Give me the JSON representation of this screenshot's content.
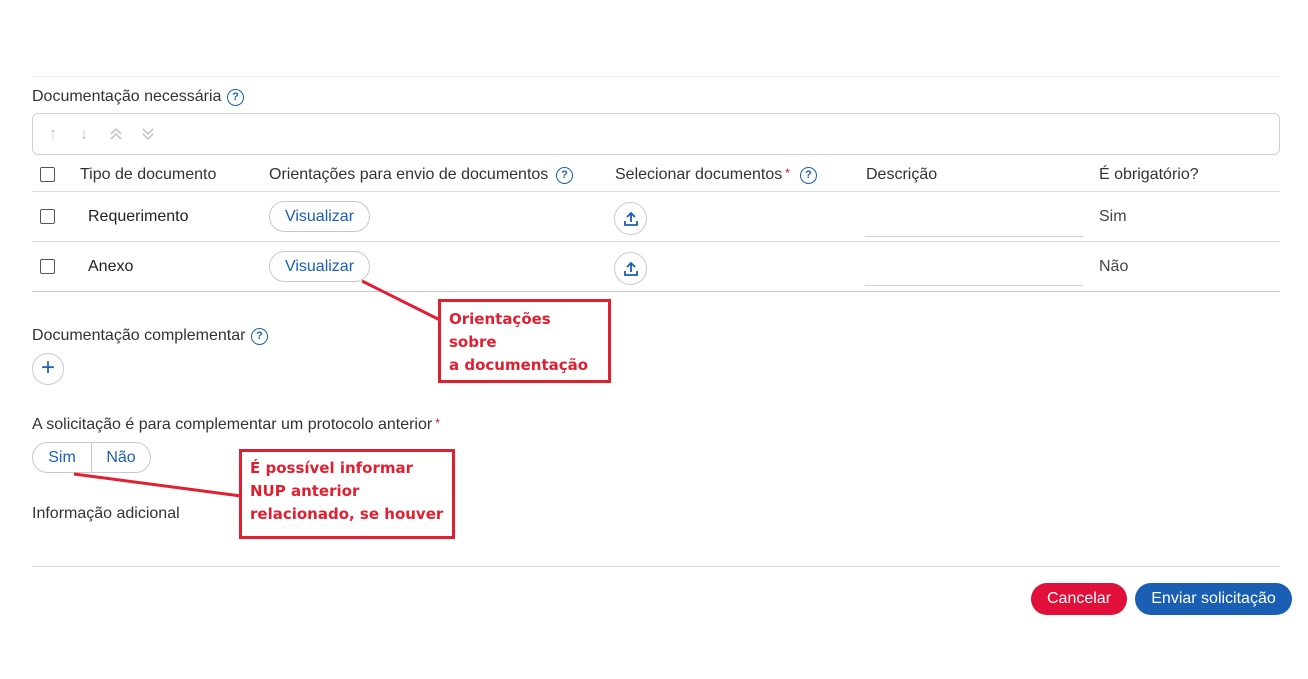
{
  "documentacao_necessaria": {
    "label": "Documentação necessária",
    "help_icon": "question-circle-icon",
    "toolbar": {
      "icons": [
        "arrow-up-icon",
        "arrow-down-icon",
        "double-arrow-up-icon",
        "double-arrow-down-icon"
      ]
    },
    "columns": {
      "tipo": "Tipo de documento",
      "orientacoes": "Orientações para envio de documentos",
      "selecionar": "Selecionar documentos",
      "descricao": "Descrição",
      "obrigatorio": "É obrigatório?"
    },
    "rows": [
      {
        "tipo": "Requerimento",
        "orientacoes_button": "Visualizar",
        "upload_icon": "upload-icon",
        "descricao": "",
        "obrigatorio": "Sim"
      },
      {
        "tipo": "Anexo",
        "orientacoes_button": "Visualizar",
        "upload_icon": "upload-icon",
        "descricao": "",
        "obrigatorio": "Não"
      }
    ]
  },
  "documentacao_complementar": {
    "label": "Documentação complementar",
    "add_icon": "plus-icon"
  },
  "protocolo_anterior": {
    "label": "A solicitação é para complementar um protocolo anterior",
    "required_mark": "*",
    "options": [
      "Sim",
      "Não"
    ]
  },
  "informacao_adicional": {
    "label": "Informação adicional"
  },
  "actions": {
    "cancel": "Cancelar",
    "submit": "Enviar solicitação"
  },
  "annotations": {
    "orientacoes": [
      "Orientações sobre",
      "a documentação"
    ],
    "nup": [
      "É possível informar",
      "NUP anterior",
      "relacionado, se houver"
    ]
  },
  "colors": {
    "accent": "#1a5fb4",
    "cancel": "#e0103a",
    "annotation": "#e02030"
  }
}
